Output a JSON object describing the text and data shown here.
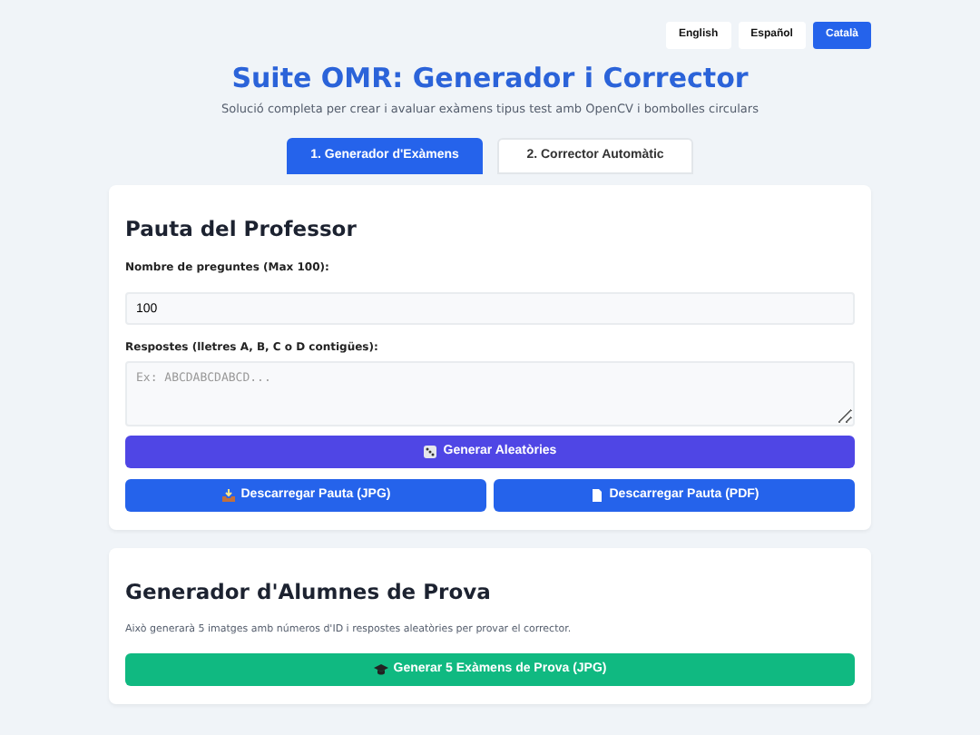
{
  "languages": [
    {
      "label": "English",
      "selected": false
    },
    {
      "label": "Español",
      "selected": false
    },
    {
      "label": "Català",
      "selected": true
    }
  ],
  "title": "Suite OMR: Generador i Corrector",
  "subtitle": "Solució completa per crear i avaluar exàmens tipus test amb OpenCV i bombolles circulars",
  "tabs": [
    {
      "label": "1. Generador d'Exàmens",
      "selected": true
    },
    {
      "label": "2. Corrector Automàtic",
      "selected": false
    }
  ],
  "teacher_key": {
    "heading": "Pauta del Professor",
    "questions_label": "Nombre de preguntes (Max 100):",
    "questions_value": "100",
    "answers_label": "Respostes (lletres A, B, C o D contigües):",
    "answers_placeholder": "Ex: ABCDABCDABCD...",
    "random_button": {
      "label": "Generar Aleatòries"
    },
    "download_buttons": [
      {
        "label": "Descarregar Pauta (JPG)"
      },
      {
        "label": "Descarregar Pauta (PDF)"
      }
    ]
  },
  "test_students": {
    "heading": "Generador d'Alumnes de Prova",
    "description": "Això generarà 5 imatges amb números d'ID i respostes aleatòries per provar el corrector.",
    "button": {
      "label": "Generar 5 Exàmens de Prova (JPG)"
    }
  }
}
